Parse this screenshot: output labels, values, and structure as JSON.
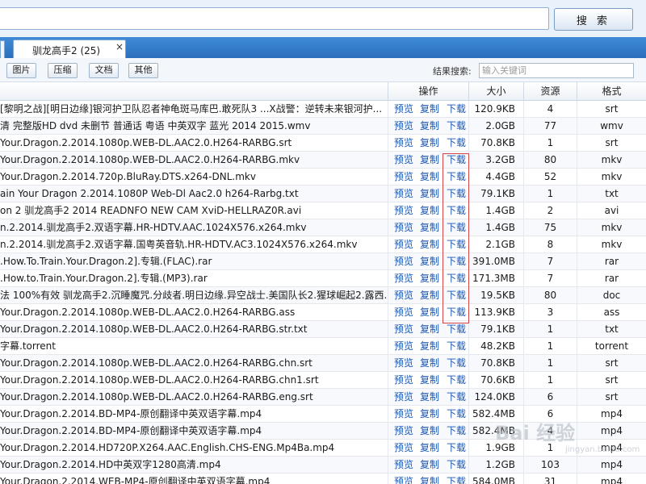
{
  "search": {
    "value": "",
    "button_label": "搜 索"
  },
  "tabs": [
    {
      "label": "驯龙高手2 (25)",
      "close": "×"
    }
  ],
  "filters": [
    "图片",
    "压缩",
    "文档",
    "其他"
  ],
  "result_search": {
    "label": "结果搜索:",
    "placeholder": "输入关键词"
  },
  "columns": {
    "action": "操作",
    "size": "大小",
    "sources": "资源",
    "format": "格式"
  },
  "actions": {
    "preview": "预览",
    "copy": "复制",
    "download": "下载"
  },
  "rows": [
    {
      "name": "[黎明之战][明日边缘]银河护卫队忍者神龟斑马库巴.敢死队3 ...X战警：逆转未来银河护...",
      "size": "120.9KB",
      "sources": "4",
      "format": "srt"
    },
    {
      "name": "清 完整版HD dvd 未删节 普通话 粤语 中英双字 蓝光 2014 2015.wmv",
      "size": "2.0GB",
      "sources": "77",
      "format": "wmv"
    },
    {
      "name": "Your.Dragon.2.2014.1080p.WEB-DL.AAC2.0.H264-RARBG.srt",
      "size": "70.8KB",
      "sources": "1",
      "format": "srt"
    },
    {
      "name": "Your.Dragon.2.2014.1080p.WEB-DL.AAC2.0.H264-RARBG.mkv",
      "size": "3.2GB",
      "sources": "80",
      "format": "mkv"
    },
    {
      "name": "Your.Dragon.2.2014.720p.BluRay.DTS.x264-DNL.mkv",
      "size": "4.4GB",
      "sources": "52",
      "format": "mkv"
    },
    {
      "name": "ain Your Dragon 2.2014.1080P Web-Dl Aac2.0 h264-Rarbg.txt",
      "size": "79.1KB",
      "sources": "1",
      "format": "txt"
    },
    {
      "name": "on 2 驯龙高手2 2014 READNFO NEW CAM XviD-HELLRAZ0R.avi",
      "size": "1.4GB",
      "sources": "2",
      "format": "avi"
    },
    {
      "name": "n.2.2014.驯龙高手2.双语字幕.HR-HDTV.AAC.1024X576.x264.mkv",
      "size": "1.4GB",
      "sources": "75",
      "format": "mkv"
    },
    {
      "name": "n.2.2014.驯龙高手2.双语字幕.国粤英音轨.HR-HDTV.AC3.1024X576.x264.mkv",
      "size": "2.1GB",
      "sources": "8",
      "format": "mkv"
    },
    {
      "name": ".How.To.Train.Your.Dragon.2].专辑.(FLAC).rar",
      "size": "391.0MB",
      "sources": "7",
      "format": "rar"
    },
    {
      "name": ".How.to.Train.Your.Dragon.2].专辑.(MP3).rar",
      "size": "171.3MB",
      "sources": "7",
      "format": "rar"
    },
    {
      "name": "法 100%有效 驯龙高手2.沉睡魔咒.分歧者.明日边缘.异空战士.美国队长2.猩球崛起2.露西...",
      "size": "19.5KB",
      "sources": "80",
      "format": "doc"
    },
    {
      "name": "Your.Dragon.2.2014.1080p.WEB-DL.AAC2.0.H264-RARBG.ass",
      "size": "113.9KB",
      "sources": "3",
      "format": "ass"
    },
    {
      "name": "Your.Dragon.2.2014.1080p.WEB-DL.AAC2.0.H264-RARBG.str.txt",
      "size": "79.1KB",
      "sources": "1",
      "format": "txt"
    },
    {
      "name": "字幕.torrent",
      "size": "48.2KB",
      "sources": "1",
      "format": "torrent"
    },
    {
      "name": "Your.Dragon.2.2014.1080p.WEB-DL.AAC2.0.H264-RARBG.chn.srt",
      "size": "70.8KB",
      "sources": "1",
      "format": "srt"
    },
    {
      "name": "Your.Dragon.2.2014.1080p.WEB-DL.AAC2.0.H264-RARBG.chn1.srt",
      "size": "70.6KB",
      "sources": "1",
      "format": "srt"
    },
    {
      "name": "Your.Dragon.2.2014.1080p.WEB-DL.AAC2.0.H264-RARBG.eng.srt",
      "size": "124.0KB",
      "sources": "6",
      "format": "srt"
    },
    {
      "name": "Your.Dragon.2.2014.BD-MP4-原创翻译中英双语字幕.mp4",
      "size": "582.4MB",
      "sources": "6",
      "format": "mp4"
    },
    {
      "name": "Your.Dragon.2.2014.BD-MP4-原创翻译中英双语字幕.mp4",
      "size": "582.4MB",
      "sources": "4",
      "format": "mp4"
    },
    {
      "name": "Your.Dragon.2.2014.HD720P.X264.AAC.English.CHS-ENG.Mp4Ba.mp4",
      "size": "1.9GB",
      "sources": "1",
      "format": "mp4"
    },
    {
      "name": "Your.Dragon.2.2014.HD中英双字1280高清.mp4",
      "size": "1.2GB",
      "sources": "103",
      "format": "mp4"
    },
    {
      "name": "Your.Dragon.2.2014.WEB-MP4-原创翻译中英双语字幕.mp4",
      "size": "584.0MB",
      "sources": "31",
      "format": "mp4"
    }
  ],
  "watermark": {
    "logo": "Bai 经验",
    "sub": "jingyan.baidu.com"
  }
}
